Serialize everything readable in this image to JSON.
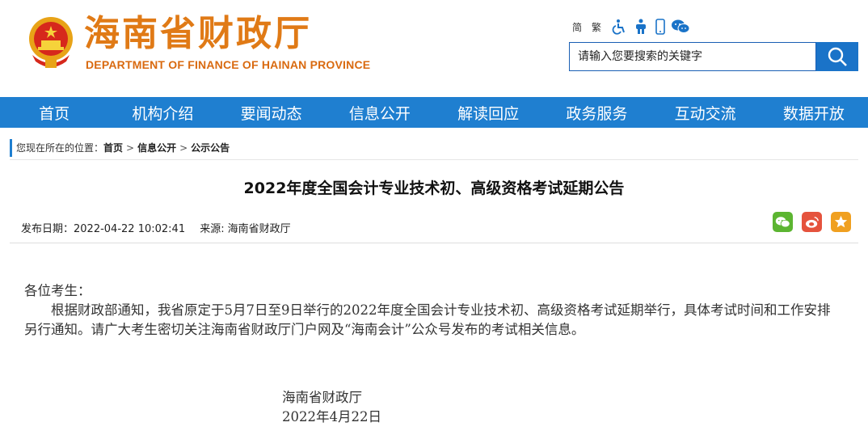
{
  "header": {
    "logo_title": "海南省财政厅",
    "logo_subtitle": "DEPARTMENT OF FINANCE OF HAINAN PROVINCE",
    "tools": {
      "simplified": "简",
      "traditional": "繁"
    }
  },
  "search": {
    "placeholder": "请输入您要搜索的关键字"
  },
  "nav": [
    "首页",
    "机构介绍",
    "要闻动态",
    "信息公开",
    "解读回应",
    "政务服务",
    "互动交流",
    "数据开放"
  ],
  "breadcrumb": {
    "prefix": "您现在所在的位置：",
    "items": [
      "首页",
      "信息公开",
      "公示公告"
    ],
    "separator": ">"
  },
  "article": {
    "title": "2022年度全国会计专业技术初、高级资格考试延期公告",
    "date_label": "发布日期：",
    "date": "2022-04-22 10:02:41",
    "source_label": "来源:",
    "source": "海南省财政厅",
    "greeting": "各位考生：",
    "body": "根据财政部通知，我省原定于5月7日至9日举行的2022年度全国会计专业技术初、高级资格考试延期举行，具体考试时间和工作安排另行通知。请广大考生密切关注海南省财政厅门户网及“海南会计”公众号发布的考试相关信息。",
    "signature": "海南省财政厅",
    "sign_date": "2022年4月22日"
  },
  "colors": {
    "brand_orange": "#e07a16",
    "nav_blue": "#1f7fd0",
    "wechat": "#5cb531",
    "weibo": "#e5533d",
    "favorite": "#f0a020"
  }
}
